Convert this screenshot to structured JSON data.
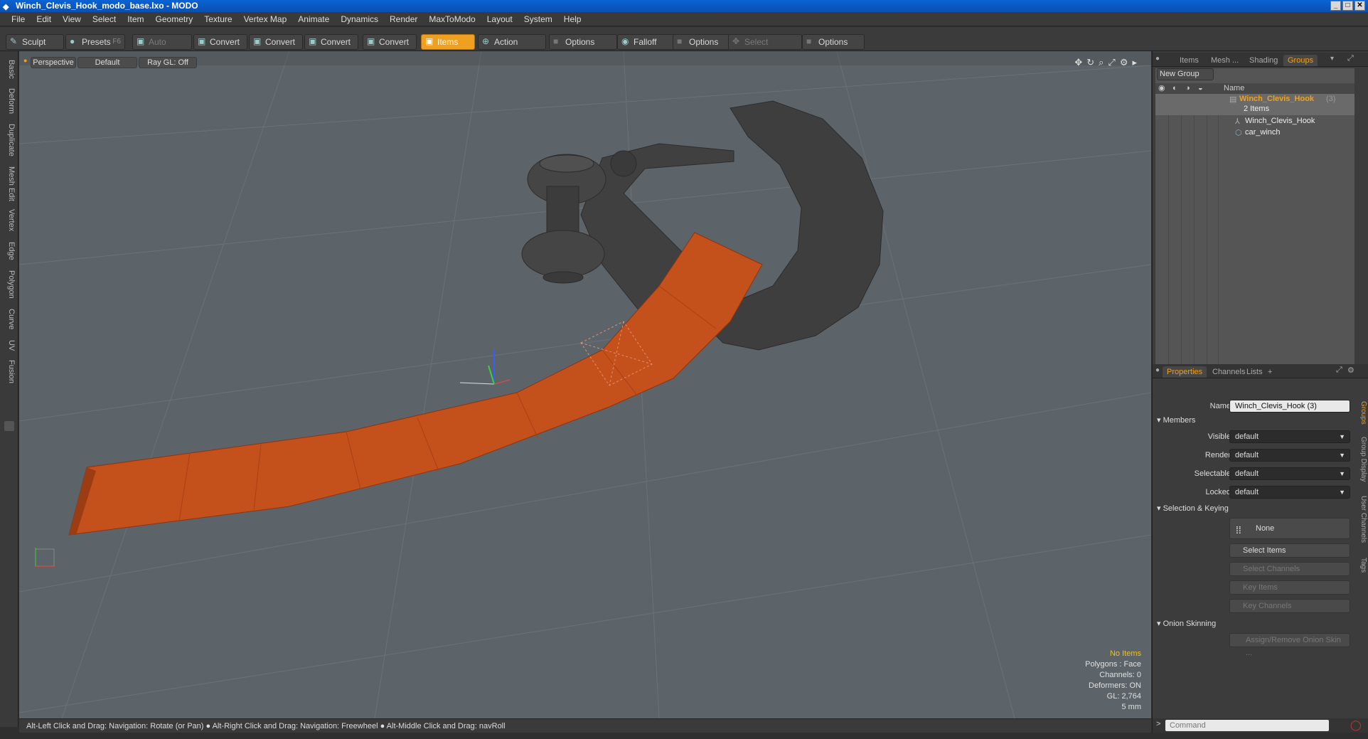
{
  "window": {
    "title": "Winch_Clevis_Hook_modo_base.lxo - MODO"
  },
  "menu": [
    "File",
    "Edit",
    "View",
    "Select",
    "Item",
    "Geometry",
    "Texture",
    "Vertex Map",
    "Animate",
    "Dynamics",
    "Render",
    "MaxToModo",
    "Layout",
    "System",
    "Help"
  ],
  "toolbar": {
    "sculpt": "Sculpt",
    "presets": "Presets",
    "presets_hotkey": "F6",
    "auto_select": "Auto Select",
    "convert1": "Convert",
    "convert2": "Convert",
    "convert3": "Convert",
    "convert4": "Convert",
    "items": "Items",
    "action_center": "Action Center",
    "options1": "Options",
    "falloff": "Falloff",
    "options2": "Options",
    "select_through": "Select Through",
    "options3": "Options"
  },
  "left_tabs": [
    "Basic",
    "Deform",
    "Duplicate",
    "Mesh Edit",
    "Vertex",
    "Edge",
    "Polygon",
    "Curve",
    "UV",
    "Fusion"
  ],
  "viewport": {
    "perspective": "Perspective",
    "default": "Default",
    "raygl": "Ray GL: Off",
    "hud": {
      "items": "No Items",
      "polygons": "Polygons : Face",
      "channels": "Channels: 0",
      "deformers": "Deformers: ON",
      "gl": "GL: 2,764",
      "scale": "5 mm"
    }
  },
  "status": "Alt-Left Click and Drag: Navigation: Rotate (or Pan) ● Alt-Right Click and Drag: Navigation: Freewheel ● Alt-Middle Click and Drag: navRoll",
  "right": {
    "top_tabs": [
      "Items",
      "Mesh ...",
      "Shading",
      "Groups"
    ],
    "new_group": "New Group",
    "name_col": "Name",
    "group_name": "Winch_Clevis_Hook",
    "group_count": "(3)",
    "group_items": "2 Items",
    "child1": "Winch_Clevis_Hook",
    "child2": "car_winch",
    "prop_tabs": [
      "Properties",
      "Channels",
      "Lists",
      "+"
    ],
    "name_label": "Name",
    "name_value": "Winch_Clevis_Hook (3)",
    "members": "Members",
    "visible_label": "Visible",
    "visible_value": "default",
    "render_label": "Render",
    "render_value": "default",
    "selectable_label": "Selectable",
    "selectable_value": "default",
    "locked_label": "Locked",
    "locked_value": "default",
    "sel_keying": "Selection & Keying",
    "none": "None",
    "select_items": "Select Items",
    "select_channels": "Select Channels",
    "key_items": "Key Items",
    "key_channels": "Key Channels",
    "onion": "Onion Skinning",
    "assign_onion": "Assign/Remove Onion Skin ...",
    "side_tabs": [
      "Groups",
      "Group Display",
      "User Channels",
      "Tags"
    ],
    "command": "Command"
  }
}
